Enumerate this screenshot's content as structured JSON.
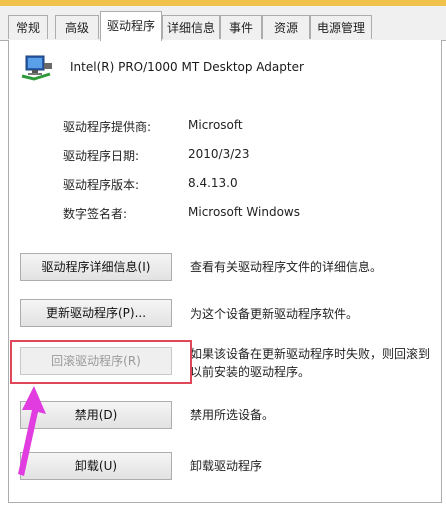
{
  "colors": {
    "tab_border": "#adadad",
    "highlight_box": "#e0485a",
    "arrow": "#e03ce0",
    "top_strip": "#f0c24a"
  },
  "tabs": [
    {
      "label": "常规",
      "active": false
    },
    {
      "label": "高级",
      "active": false
    },
    {
      "label": "驱动程序",
      "active": true
    },
    {
      "label": "详细信息",
      "active": false
    },
    {
      "label": "事件",
      "active": false
    },
    {
      "label": "资源",
      "active": false
    },
    {
      "label": "电源管理",
      "active": false
    }
  ],
  "device": {
    "icon": "network-adapter-icon",
    "name": "Intel(R) PRO/1000 MT Desktop Adapter"
  },
  "properties": [
    {
      "label": "驱动程序提供商:",
      "value": "Microsoft"
    },
    {
      "label": "驱动程序日期:",
      "value": "2010/3/23"
    },
    {
      "label": "驱动程序版本:",
      "value": "8.4.13.0"
    },
    {
      "label": "数字签名者:",
      "value": "Microsoft Windows"
    }
  ],
  "actions": [
    {
      "button": "驱动程序详细信息(I)",
      "description": "查看有关驱动程序文件的详细信息。",
      "enabled": true
    },
    {
      "button": "更新驱动程序(P)...",
      "description": "为这个设备更新驱动程序软件。",
      "enabled": true
    },
    {
      "button": "回滚驱动程序(R)",
      "description": "如果该设备在更新驱动程序时失败，则回滚到以前安装的驱动程序。",
      "enabled": false
    },
    {
      "button": "禁用(D)",
      "description": "禁用所选设备。",
      "enabled": true
    },
    {
      "button": "卸载(U)",
      "description": "卸载驱动程序",
      "enabled": true
    }
  ]
}
